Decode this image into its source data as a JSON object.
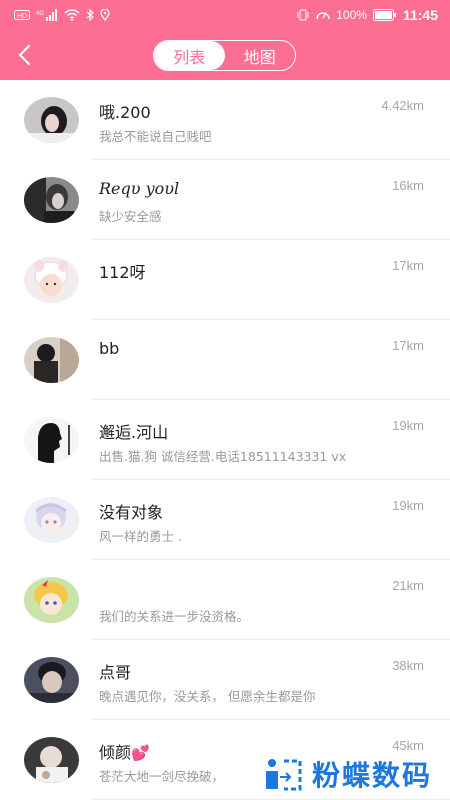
{
  "status_bar": {
    "carrier_badge": "HD",
    "network": "4G",
    "battery_percent": "100%",
    "time": "11:45"
  },
  "header": {
    "tabs": [
      {
        "label": "列表",
        "active": true
      },
      {
        "label": "地图",
        "active": false
      }
    ]
  },
  "list": [
    {
      "name": "哦.200",
      "signature": "我总不能说自己贱吧",
      "distance": "4.42km"
    },
    {
      "name": "Reqυ yoυl",
      "signature": "缺少安全感",
      "distance": "16km"
    },
    {
      "name": "112呀",
      "signature": "",
      "distance": "17km"
    },
    {
      "name": "bb",
      "signature": "",
      "distance": "17km"
    },
    {
      "name": "邂逅.河山",
      "signature": "出售.猫.狗  诚信经营.电话18511143331 vx",
      "distance": "19km"
    },
    {
      "name": "没有对象",
      "signature": "风一样的勇士 .",
      "distance": "19km"
    },
    {
      "name": "",
      "signature": "我们的关系进一步没资格。",
      "distance": "21km"
    },
    {
      "name": " 点哥",
      "signature": "晚点遇见你，没关系， 但愿余生都是你",
      "distance": "38km"
    },
    {
      "name": " 倾颜",
      "signature": "苍茫大地一剑尽挽破，",
      "distance": "45km"
    }
  ],
  "watermark": {
    "text": "粉蝶数码"
  },
  "colors": {
    "brand": "#fd6e93",
    "distance": "#a6a6a6",
    "watermark": "#1a78e0"
  }
}
